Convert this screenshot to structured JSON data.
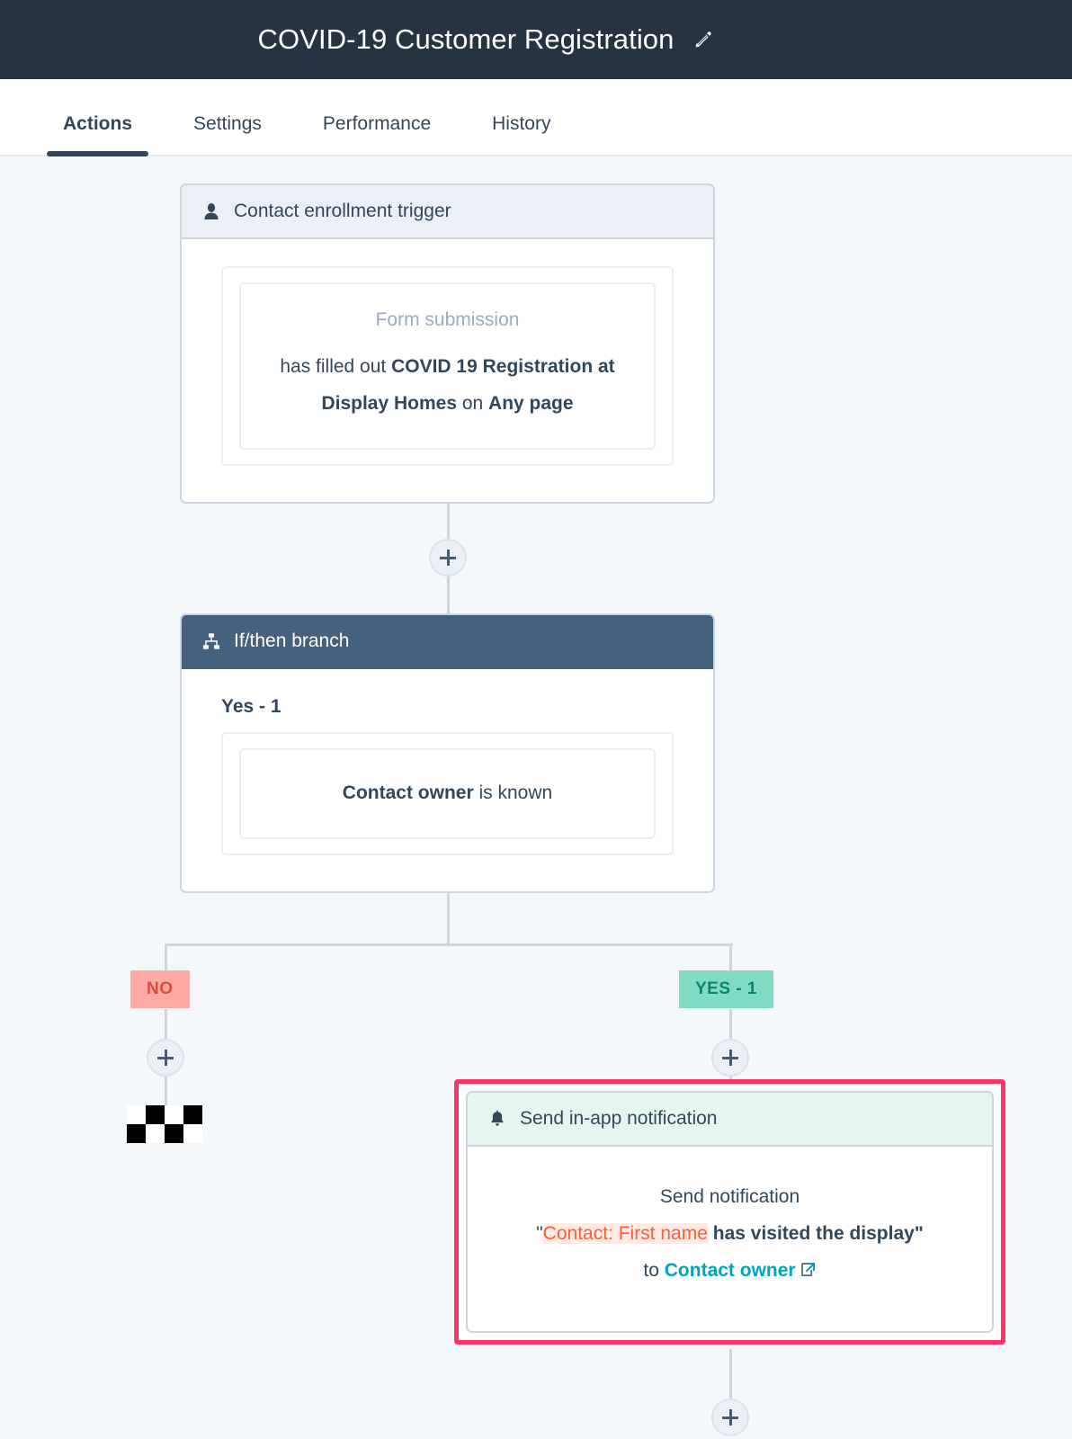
{
  "header": {
    "title": "COVID-19 Customer Registration",
    "edit_icon": "pencil-icon",
    "bg_color": "#253342"
  },
  "tabs": [
    {
      "label": "Actions",
      "active": true
    },
    {
      "label": "Settings",
      "active": false
    },
    {
      "label": "Performance",
      "active": false
    },
    {
      "label": "History",
      "active": false
    }
  ],
  "workflow": {
    "trigger_card": {
      "header_icon": "contact-person-icon",
      "header_label": "Contact enrollment trigger",
      "filter_type": "Form submission",
      "statement_prefix": "has filled out ",
      "form_name": "COVID 19 Registration at Display Homes",
      "statement_middle": " on ",
      "page_scope": "Any page"
    },
    "branch_card": {
      "header_icon": "branch-icon",
      "header_label": "If/then branch",
      "branch_name": "Yes - 1",
      "condition_property": "Contact owner",
      "condition_operator": " is known"
    },
    "branch_outcomes": [
      {
        "label": "NO",
        "color": "#feaaa4",
        "text_color": "#d94c3d"
      },
      {
        "label": "YES - 1",
        "color": "#7fdbc4",
        "text_color": "#0a8768"
      }
    ],
    "no_branch_end": {
      "icon": "checkered-flag-icon"
    },
    "notification_card": {
      "highlighted": true,
      "highlight_color": "#ff3366",
      "header_icon": "bell-icon",
      "header_label": "Send in-app notification",
      "line1": "Send notification",
      "quote_open": "\"",
      "token": "Contact: First name",
      "message_rest": " has visited the display",
      "quote_close": "\"",
      "recipient_prefix": "to ",
      "recipient": "Contact owner",
      "recipient_icon": "external-link-icon"
    },
    "add_buttons": [
      {
        "name": "add-action-after-trigger",
        "label": "+"
      },
      {
        "name": "add-action-no-branch",
        "label": "+"
      },
      {
        "name": "add-action-yes-branch",
        "label": "+"
      },
      {
        "name": "add-action-after-notification",
        "label": "+"
      }
    ]
  }
}
